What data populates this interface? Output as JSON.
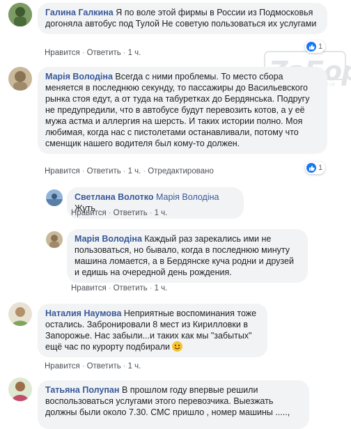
{
  "watermark": {
    "text": "ZaБор",
    "sub": "www.zabor.zp.ua"
  },
  "labels": {
    "like": "Нравится",
    "reply": "Ответить",
    "edited": "Отредактировано"
  },
  "comments": [
    {
      "author": "Галина Галкина",
      "text": "Я по воле этой фирмы в России из Подмосковья догоняла автобус под Тулой Не советую пользоваться их услугами",
      "time": "1 ч.",
      "reactions": "1"
    },
    {
      "author": "Марія Володіна",
      "text": "Всегда с ними проблемы. То место сбора меняется в последнюю секунду, то пассажиры до Васильевского рынка стоя едут, а от туда на табуретках до Бердянська. Подругу не предупредили, что в автобусе будут перевозить котов, а у её мужа астма и аллергия на шерсть. И таких истории полно. Моя любимая, когда нас с пистолетами останавливали, потому что сменщик нашего водителя был кому-то должен.",
      "time": "1 ч.",
      "reactions": "1"
    },
    {
      "author": "Светлана Волотко",
      "mention": "Марія Володіна",
      "text": "Жуть",
      "time": "1 ч."
    },
    {
      "author": "Марія Володіна",
      "text": "Каждый раз зарекались ими не пользоваться, но бывало, когда в последнюю минуту машина ломается, а в Бердянске куча родни и друзей и едишь на очередной день рождения.",
      "time": "1 ч."
    },
    {
      "author": "Наталия Наумова",
      "text": "Неприятные воспоминания тоже остались. Забронировали 8 мест из Кирилловки в Запорожье. Нас забыли...и таких как мы \"забытых\" ещё час по курорту подбирали",
      "time": "1 ч."
    },
    {
      "author": "Татьяна Полупан",
      "text": "В прошлом году впервые решили воспользоваться услугами этого перевозчика. Выезжать должны были около 7.30. СМС пришло , номер машины .....,"
    }
  ]
}
